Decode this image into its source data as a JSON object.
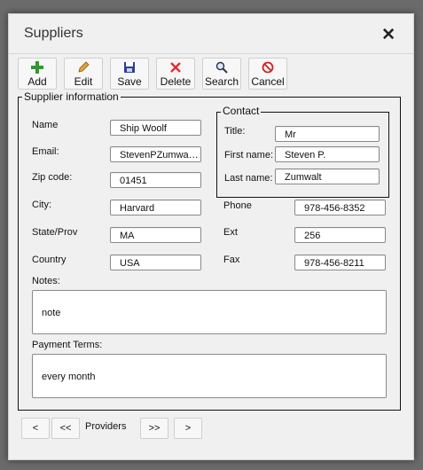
{
  "dialog": {
    "title": "Suppliers"
  },
  "toolbar": {
    "add": "Add",
    "edit": "Edit",
    "save": "Save",
    "delete": "Delete",
    "search": "Search",
    "cancel": "Cancel"
  },
  "form": {
    "legend": "Supplier information",
    "contact_legend": "Contact",
    "labels": {
      "name": "Name",
      "email": "Email:",
      "zip": "Zip code:",
      "city": "City:",
      "state": "State/Prov",
      "country": "Country",
      "notes": "Notes:",
      "payment": "Payment Terms:",
      "title": "Title:",
      "first_name": "First name:",
      "last_name": "Last name:",
      "phone": "Phone",
      "ext": "Ext",
      "fax": "Fax"
    },
    "values": {
      "name": "Ship Woolf",
      "email": "StevenPZumwalt@example.com",
      "zip": "01451",
      "city": "Harvard",
      "state": "MA",
      "country": "USA",
      "title": "Mr",
      "first_name": "Steven P.",
      "last_name": "Zumwalt",
      "phone": "978-456-8352",
      "ext": "256",
      "fax": "978-456-8211",
      "notes": "note",
      "payment": "every month"
    }
  },
  "pager": {
    "prev": "<",
    "first": "<<",
    "label": "Providers",
    "last": ">>",
    "next": ">"
  },
  "colors": {
    "add_icon": "#2e9a2e",
    "delete_icon": "#e03030",
    "save_icon": "#2a3f9a",
    "cancel_icon": "#d02020"
  }
}
